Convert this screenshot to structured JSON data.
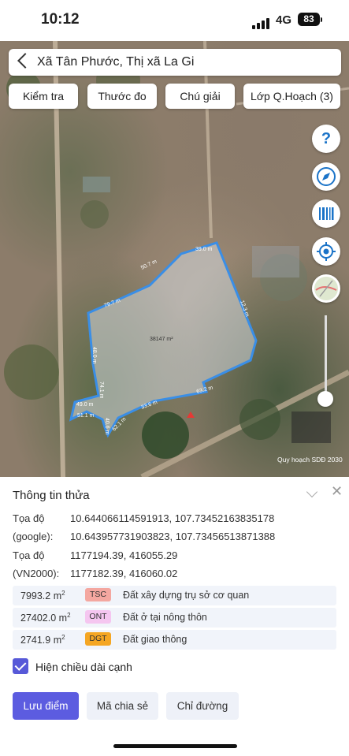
{
  "status_bar": {
    "time": "10:12",
    "network": "4G",
    "battery": "83"
  },
  "search": {
    "title": "Xã Tân Phước, Thị xã La Gi"
  },
  "chips": [
    "Kiểm tra",
    "Thước đo",
    "Chú giải",
    "Lớp Q.Hoạch (3)"
  ],
  "fab_icons": [
    "help-icon",
    "compass-icon",
    "barcode-icon",
    "locate-icon",
    "map-layer-icon"
  ],
  "map": {
    "parcel_area": "38147 m²",
    "edge_labels": [
      "39.0 m",
      "50.7 m",
      "79.7 m",
      "48.0 m",
      "74.1 m",
      "49.0 m",
      "51.1 m",
      "40.6 m",
      "62.1 m",
      "33.6 m",
      "63.2 m",
      "12.3 m"
    ],
    "attribution": "Quy hoạch SDĐ 2030",
    "parcel_color": "#3a8ee6"
  },
  "panel": {
    "title": "Thông tin thửa",
    "coords": [
      {
        "label": "Tọa độ",
        "value": "10.644066114591913, 107.73452163835178"
      },
      {
        "label": "(google):",
        "value": "10.643957731903823, 107.73456513871388"
      },
      {
        "label": "Tọa độ",
        "value": "1177194.39, 416055.29"
      },
      {
        "label": "(VN2000):",
        "value": "1177182.39, 416060.02"
      }
    ],
    "land_use": [
      {
        "area": "7993.2 m",
        "code": "TSC",
        "desc": "Đất xây dựng trụ sở cơ quan",
        "color": "#f4a7a0"
      },
      {
        "area": "27402.0 m",
        "code": "ONT",
        "desc": "Đất ở tại nông thôn",
        "color": "#f5c6f0"
      },
      {
        "area": "2741.9 m",
        "code": "DGT",
        "desc": "Đất giao thông",
        "color": "#f5a623"
      }
    ],
    "area_sup": "2",
    "checkbox_label": "Hiện chiều dài cạnh",
    "buttons": {
      "save": "Lưu điểm",
      "share": "Mã chia sẻ",
      "directions": "Chỉ đường"
    }
  }
}
